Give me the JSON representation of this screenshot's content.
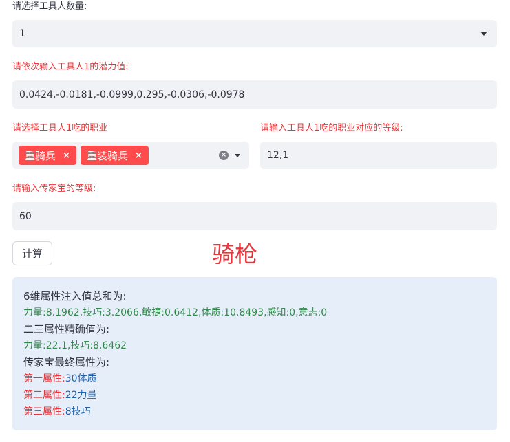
{
  "worker_count": {
    "label": "请选择工具人数量:",
    "value": "1"
  },
  "potential": {
    "label": "请依次输入工具人1的潜力值:",
    "value": "0.0424,-0.0181,-0.0999,0.295,-0.0306,-0.0978"
  },
  "jobs": {
    "label": "请选择工具人1吃的职业",
    "tags": [
      "重骑兵",
      "重装骑兵"
    ],
    "remove_glyph": "×",
    "clear_glyph": "×"
  },
  "job_levels": {
    "label": "请输入工具人1吃的职业对应的等级:",
    "value": "12,1"
  },
  "heirloom_level": {
    "label": "请输入传家宝的等级:",
    "value": "60"
  },
  "calc_button": "计算",
  "result_big": "骑枪",
  "results": {
    "header1": "6维属性注入值总和为:",
    "line1": "力量:8.1962,技巧:3.2066,敏捷:0.6412,体质:10.8493,感知:0,意志:0",
    "header2": "二三属性精确值为:",
    "line2": "力量:22.1,技巧:8.6462",
    "header3": "传家宝最终属性为:",
    "attr1_label": "第一属性:",
    "attr1_value": "30体质",
    "attr2_label": "第二属性:",
    "attr2_value": "22力量",
    "attr3_label": "第三属性:",
    "attr3_value": "8技巧"
  },
  "colors": {
    "accent_red": "#ff4b4b",
    "label_red": "#e8363a",
    "green_text": "#318a4a",
    "blue_text": "#1f5fad",
    "info_bg": "#e6eff9"
  }
}
